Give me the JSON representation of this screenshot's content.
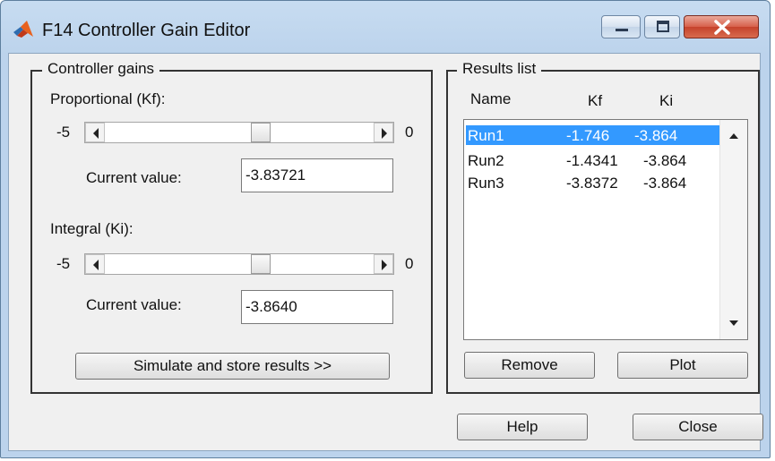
{
  "window": {
    "title": "F14 Controller Gain Editor",
    "icons": [
      "matlab-logo-icon",
      "minimize-icon",
      "maximize-icon",
      "close-icon"
    ]
  },
  "controller_gains": {
    "group_label": "Controller gains",
    "proportional": {
      "label": "Proportional (Kf):",
      "min": "-5",
      "max": "0",
      "current_label": "Current value:",
      "value": "-3.83721"
    },
    "integral": {
      "label": "Integral (Ki):",
      "min": "-5",
      "max": "0",
      "current_label": "Current value:",
      "value": "-3.8640"
    },
    "simulate_button": "Simulate and store results >>"
  },
  "results": {
    "group_label": "Results list",
    "columns": [
      "Name",
      "Kf",
      "Ki"
    ],
    "rows": [
      {
        "name": "Run1",
        "kf": "-1.746",
        "ki": "-3.864",
        "selected": true
      },
      {
        "name": "Run2",
        "kf": "-1.4341",
        "ki": "-3.864",
        "selected": false
      },
      {
        "name": "Run3",
        "kf": "-3.8372",
        "ki": "-3.864",
        "selected": false
      }
    ],
    "remove_button": "Remove",
    "plot_button": "Plot"
  },
  "footer": {
    "help_button": "Help",
    "close_button": "Close"
  },
  "colors": {
    "selection": "#3399ff",
    "titlebar": "#bcd3ec",
    "close_button": "#c5432c"
  }
}
